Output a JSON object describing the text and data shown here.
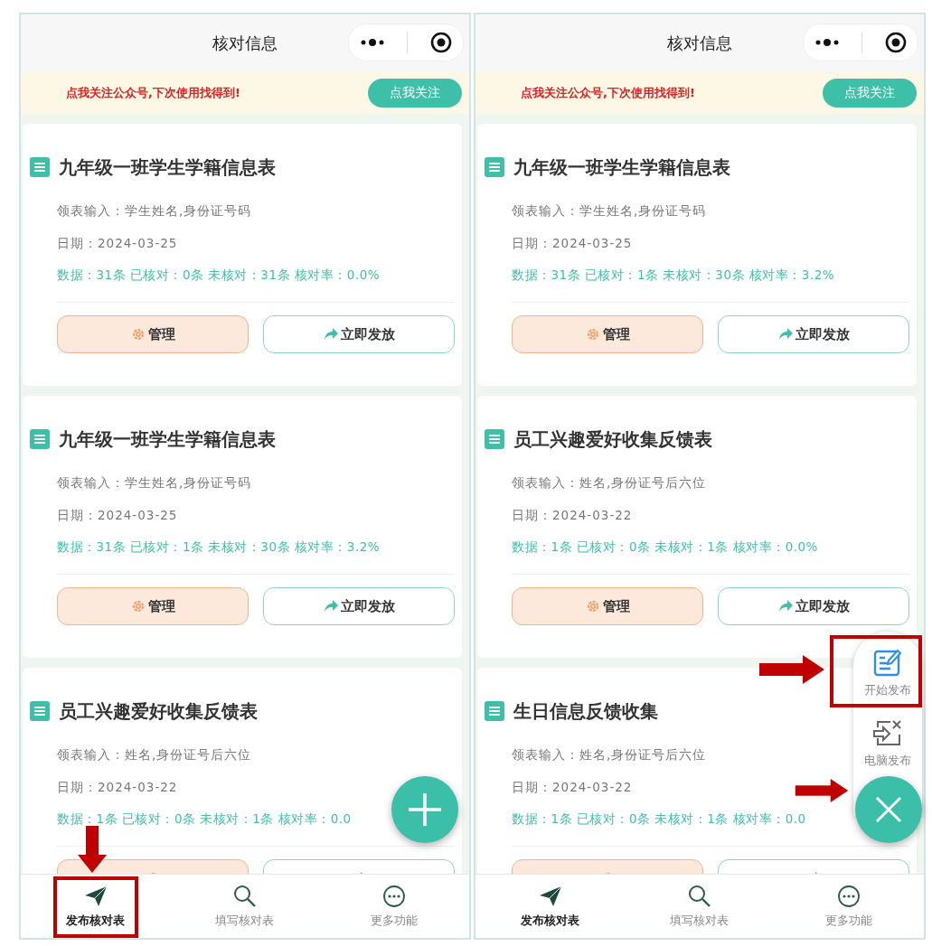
{
  "screens": [
    {
      "title": "核对信息",
      "banner": {
        "text": "点我关注公众号,下次使用找得到!",
        "button": "点我关注"
      },
      "cards": [
        {
          "title": "九年级一班学生学籍信息表",
          "fields": [
            "领表输入：学生姓名,身份证号码",
            "日期：2024-03-25"
          ],
          "stats": "数据：31条 已核对：0条 未核对：31条 核对率：0.0%",
          "buttons": [
            {
              "kind": "manage",
              "label": "管理"
            },
            {
              "kind": "send",
              "label": "立即发放"
            }
          ]
        },
        {
          "title": "九年级一班学生学籍信息表",
          "fields": [
            "领表输入：学生姓名,身份证号码",
            "日期：2024-03-25"
          ],
          "stats": "数据：31条 已核对：1条 未核对：30条 核对率：3.2%",
          "buttons": [
            {
              "kind": "manage",
              "label": "管理"
            },
            {
              "kind": "send",
              "label": "立即发放"
            }
          ]
        },
        {
          "title": "员工兴趣爱好收集反馈表",
          "fields": [
            "领表输入：姓名,身份证号后六位",
            "日期：2024-03-22"
          ],
          "stats": "数据：1条 已核对：0条 未核对：1条 核对率：0.0",
          "buttons": [
            {
              "kind": "manage"
            },
            {
              "kind": "send"
            }
          ]
        }
      ],
      "fab": {
        "kind": "add",
        "annotated": false
      },
      "tabs": [
        {
          "kind": "send",
          "label": "发布核对表",
          "selected": true,
          "annotated": true
        },
        {
          "kind": "search",
          "label": "填写核对表",
          "selected": false,
          "annotated": false
        },
        {
          "kind": "more",
          "label": "更多功能",
          "selected": false,
          "annotated": false
        }
      ]
    },
    {
      "title": "核对信息",
      "banner": {
        "text": "点我关注公众号,下次使用找得到!",
        "button": "点我关注"
      },
      "cards": [
        {
          "title": "九年级一班学生学籍信息表",
          "fields": [
            "领表输入：学生姓名,身份证号码",
            "日期：2024-03-25"
          ],
          "stats": "数据：31条 已核对：1条 未核对：30条 核对率：3.2%",
          "buttons": [
            {
              "kind": "manage",
              "label": "管理"
            },
            {
              "kind": "send",
              "label": "立即发放"
            }
          ]
        },
        {
          "title": "员工兴趣爱好收集反馈表",
          "fields": [
            "领表输入：姓名,身份证号后六位",
            "日期：2024-03-22"
          ],
          "stats": "数据：1条 已核对：0条 未核对：1条 核对率：0.0%",
          "buttons": [
            {
              "kind": "manage",
              "label": "管理"
            },
            {
              "kind": "send",
              "label": "立即发放"
            }
          ]
        },
        {
          "title": "生日信息反馈收集",
          "fields": [
            "领表输入：姓名,身份证号后六位",
            "日期：2024-03-22"
          ],
          "stats": "数据：1条 已核对：0条 未核对：1条 核对率：0.0",
          "buttons": [
            {
              "kind": "manage"
            },
            {
              "kind": "send"
            }
          ]
        }
      ],
      "fab": {
        "kind": "close",
        "annotated": true,
        "menu": [
          {
            "kind": "edit",
            "label": "开始发布",
            "annotated": true
          },
          {
            "kind": "pc",
            "label": "电脑发布",
            "annotated": false
          }
        ]
      },
      "tabs": [
        {
          "kind": "send",
          "label": "发布核对表",
          "selected": true,
          "annotated": false
        },
        {
          "kind": "search",
          "label": "填写核对表",
          "selected": false,
          "annotated": false
        },
        {
          "kind": "more",
          "label": "更多功能",
          "selected": false,
          "annotated": false
        }
      ]
    }
  ]
}
